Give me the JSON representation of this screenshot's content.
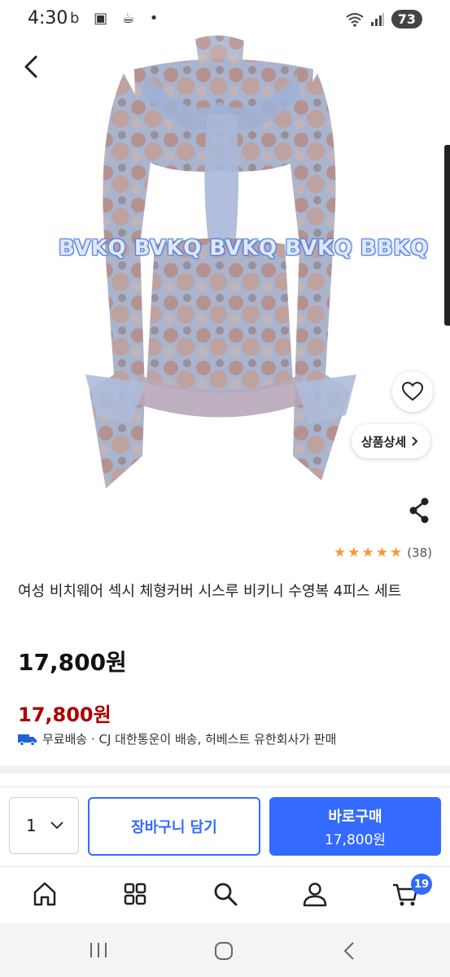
{
  "status": {
    "time": "4:30",
    "left_icons": "b ▣ ☕ •",
    "battery": "73"
  },
  "product": {
    "watermark": "BVKQ BVKQ BVKQ BVKQ BBKQ",
    "detail_label": "상품상세",
    "rating_count": "(38)",
    "rating_stars": 5,
    "title": "여성 비치웨어 섹시 체형커버 시스루 비키니 수영복 4피스 세트",
    "price": "17,800원",
    "sale_price": "17,800원",
    "shipping": "무료배송 · CJ 대한통운이 배송, 허베스트 유한회사가 판매"
  },
  "purchase": {
    "quantity": "1",
    "cart_label": "장바구니 담기",
    "buy_label": "바로구매",
    "buy_price": "17,800원"
  },
  "nav": {
    "items": [
      "home-icon",
      "category-icon",
      "search-icon",
      "user-icon",
      "cart-icon"
    ],
    "cart_badge": "19"
  },
  "colors": {
    "accent": "#346aff",
    "sale": "#ae0000",
    "star": "#f39a3c"
  }
}
